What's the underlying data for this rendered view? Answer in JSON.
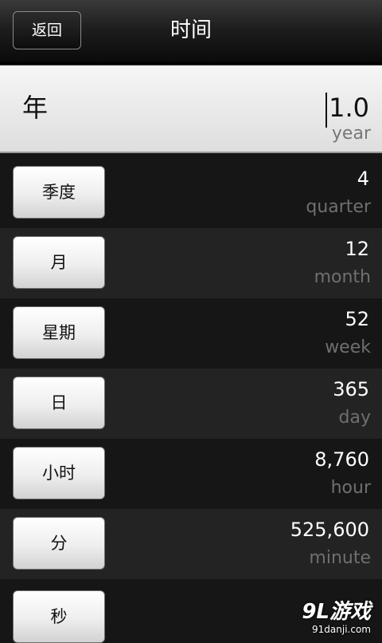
{
  "header": {
    "back_label": "返回",
    "title": "时间"
  },
  "input": {
    "label": "年",
    "value": "1.0",
    "unit": "year"
  },
  "units": [
    {
      "label": "季度",
      "value": "4",
      "unit": "quarter"
    },
    {
      "label": "月",
      "value": "12",
      "unit": "month"
    },
    {
      "label": "星期",
      "value": "52",
      "unit": "week"
    },
    {
      "label": "日",
      "value": "365",
      "unit": "day"
    },
    {
      "label": "小时",
      "value": "8,760",
      "unit": "hour"
    },
    {
      "label": "分",
      "value": "525,600",
      "unit": "minute"
    },
    {
      "label": "秒",
      "value": "",
      "unit": ""
    }
  ],
  "watermark": {
    "brand": "9L游戏",
    "url": "91danji.com"
  }
}
